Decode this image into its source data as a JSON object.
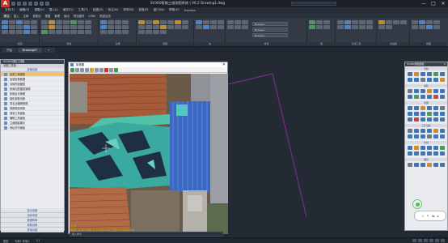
{
  "window": {
    "title": "SV360智能三维测图系统 | V6.2   Drawing1.dwg",
    "app_logo": "A",
    "controls": [
      "—",
      "□",
      "✕"
    ]
  },
  "menubar": [
    "文件(F)",
    "编辑(E)",
    "视图(V)",
    "插入(I)",
    "格式(O)",
    "工具(T)",
    "绘图(D)",
    "标注(N)",
    "修改(M)",
    "参数(P)",
    "窗口(W)",
    "帮助(H)",
    "Express"
  ],
  "ribbon_tabs": [
    {
      "label": "默认",
      "active": true
    },
    {
      "label": "插入",
      "active": false
    },
    {
      "label": "注释",
      "active": false
    },
    {
      "label": "参数化",
      "active": false
    },
    {
      "label": "视图",
      "active": false
    },
    {
      "label": "管理",
      "active": false
    },
    {
      "label": "输出",
      "active": false
    },
    {
      "label": "附加模块",
      "active": false
    },
    {
      "label": "A360",
      "active": false
    },
    {
      "label": "精选应用",
      "active": false
    }
  ],
  "ribbon_groups": [
    "绘图",
    "修改",
    "注释",
    "图层",
    "块",
    "特性",
    "组",
    "实用工具",
    "剪贴板",
    "视图"
  ],
  "layer_dropdowns": [
    "ByLayer",
    "ByLayer",
    "ByLayer"
  ],
  "doc_tabs": [
    {
      "label": "开始",
      "active": false
    },
    {
      "label": "Drawing1*",
      "active": true
    },
    {
      "label": "+",
      "active": false
    }
  ],
  "left_panel": {
    "title": "SV360测图工具箱",
    "subtitle": "测图工具箱",
    "section_top": "影像控制",
    "items": [
      {
        "label": "加载三维模型",
        "selected": true
      },
      {
        "label": "加载影像数据",
        "selected": false
      },
      {
        "label": "清除所选图层",
        "selected": false
      },
      {
        "label": "影像匹配图层管理",
        "selected": false
      },
      {
        "label": "影像反光管理",
        "selected": false
      },
      {
        "label": "相机参数设置",
        "selected": false
      },
      {
        "label": "同名点编辑管理",
        "selected": false
      },
      {
        "label": "视频检验测量",
        "selected": false
      },
      {
        "label": "测量工具面板",
        "selected": false
      },
      {
        "label": "辅助工具面板",
        "selected": false
      },
      {
        "label": "立面图窗展示",
        "selected": false
      },
      {
        "label": "地址打印面板",
        "selected": false
      }
    ],
    "footer_items": [
      "显示设置",
      "坐标系统",
      "数据转换",
      "参数设置",
      "其他功能"
    ]
  },
  "viewer": {
    "title": "影像图",
    "status_line1": "加载",
    "status_line2": "相机: 10203 相片名: DSC03245 | 像素: 7952×5304"
  },
  "right_panel": {
    "title": "SV360测图面板",
    "sections": [
      "控制",
      "编辑",
      "绘图",
      "工矿设施",
      "管线",
      "图层"
    ]
  },
  "float_tool": [
    "☆",
    "↖",
    "⇆",
    "⌂"
  ],
  "statusbar": {
    "left_text": "模型",
    "coords": "布局1  布局2",
    "extra": "1:1"
  },
  "cmdline": "键入命令"
}
